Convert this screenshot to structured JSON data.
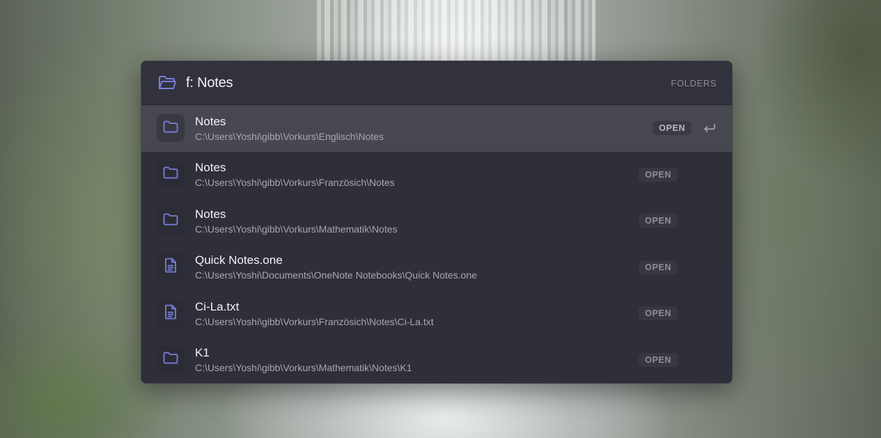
{
  "header": {
    "query": "f: Notes",
    "scope_label": "FOLDERS",
    "icon": "folder-open-icon"
  },
  "accent_color": "#7a7fdc",
  "results": [
    {
      "name": "Notes",
      "path": "C:\\Users\\Yoshi\\gibb\\Vorkurs\\Englisch\\Notes",
      "icon": "folder-icon",
      "action": "OPEN",
      "selected": true
    },
    {
      "name": "Notes",
      "path": "C:\\Users\\Yoshi\\gibb\\Vorkurs\\Französich\\Notes",
      "icon": "folder-icon",
      "action": "OPEN"
    },
    {
      "name": "Notes",
      "path": "C:\\Users\\Yoshi\\gibb\\Vorkurs\\Mathematik\\Notes",
      "icon": "folder-icon",
      "action": "OPEN"
    },
    {
      "name": "Quick Notes.one",
      "path": "C:\\Users\\Yoshi\\Documents\\OneNote Notebooks\\Quick Notes.one",
      "icon": "file-icon",
      "action": "OPEN"
    },
    {
      "name": "Ci-La.txt",
      "path": "C:\\Users\\Yoshi\\gibb\\Vorkurs\\Französich\\Notes\\Ci-La.txt",
      "icon": "file-icon",
      "action": "OPEN"
    },
    {
      "name": "K1",
      "path": "C:\\Users\\Yoshi\\gibb\\Vorkurs\\Mathematik\\Notes\\K1",
      "icon": "folder-icon",
      "action": "OPEN"
    }
  ],
  "enter_hint_icon": "return-key-icon"
}
